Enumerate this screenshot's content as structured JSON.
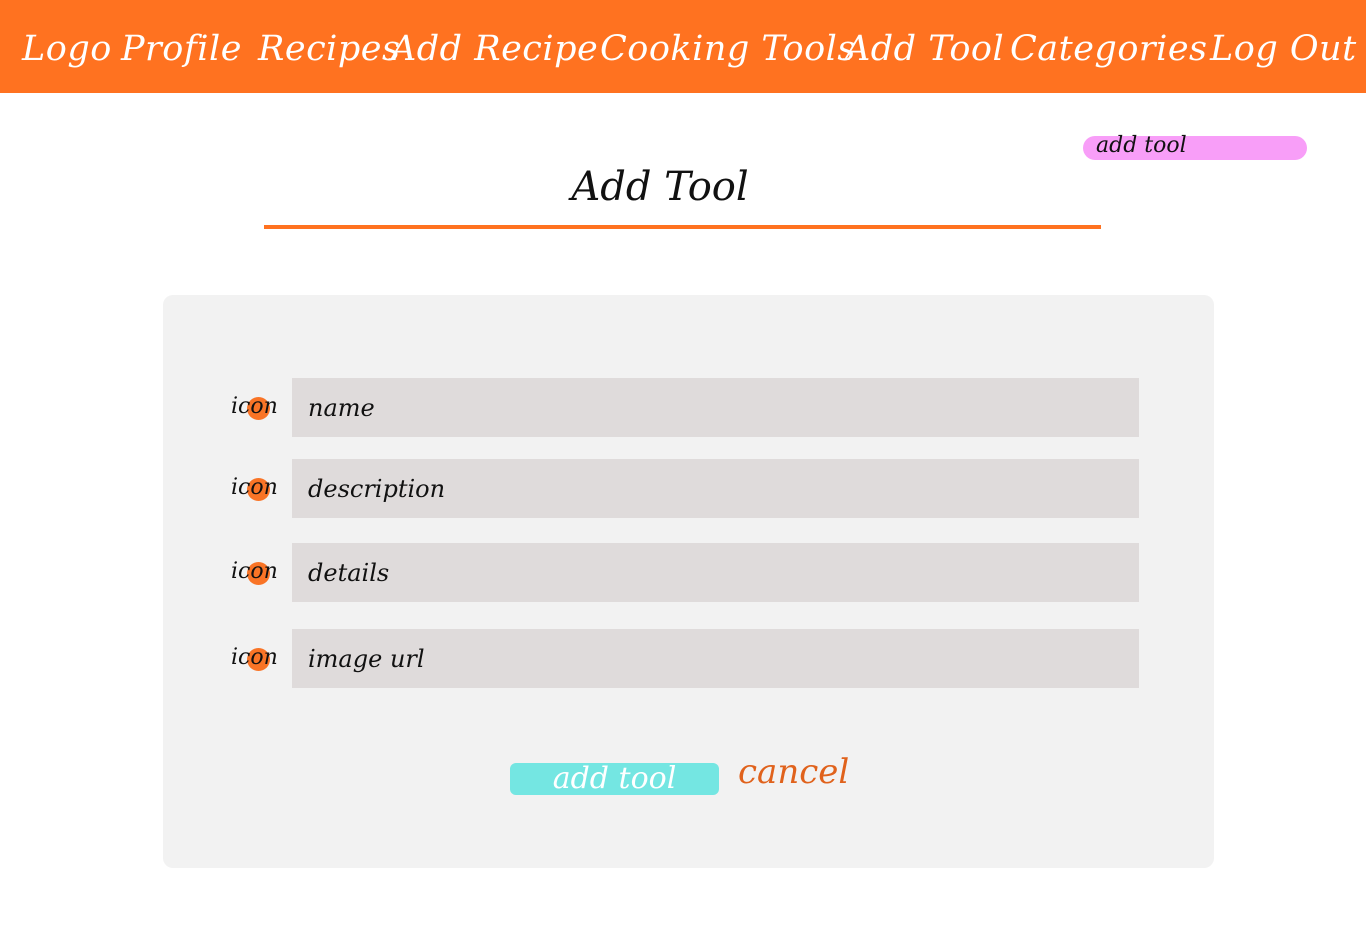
{
  "nav": {
    "items": [
      {
        "label": "Logo"
      },
      {
        "label": "Profile"
      },
      {
        "label": "Recipes"
      },
      {
        "label": "Add Recipe"
      },
      {
        "label": "Cooking Tools"
      },
      {
        "label": "Add Tool"
      },
      {
        "label": "Categories"
      },
      {
        "label": "Log Out"
      }
    ]
  },
  "annotation": {
    "label": "add tool"
  },
  "page": {
    "title": "Add Tool"
  },
  "form": {
    "fields": [
      {
        "icon_label": "icon",
        "placeholder": "name"
      },
      {
        "icon_label": "icon",
        "placeholder": "description"
      },
      {
        "icon_label": "icon",
        "placeholder": "details"
      },
      {
        "icon_label": "icon",
        "placeholder": "image url"
      }
    ],
    "submit_label": "add tool",
    "cancel_label": "cancel"
  },
  "colors": {
    "accent_orange": "#ff7220",
    "submit_cyan": "#74e6e2",
    "annotation_pink": "#f89ef8",
    "input_gray": "#dfdbdb",
    "card_gray": "#f2f2f2"
  }
}
